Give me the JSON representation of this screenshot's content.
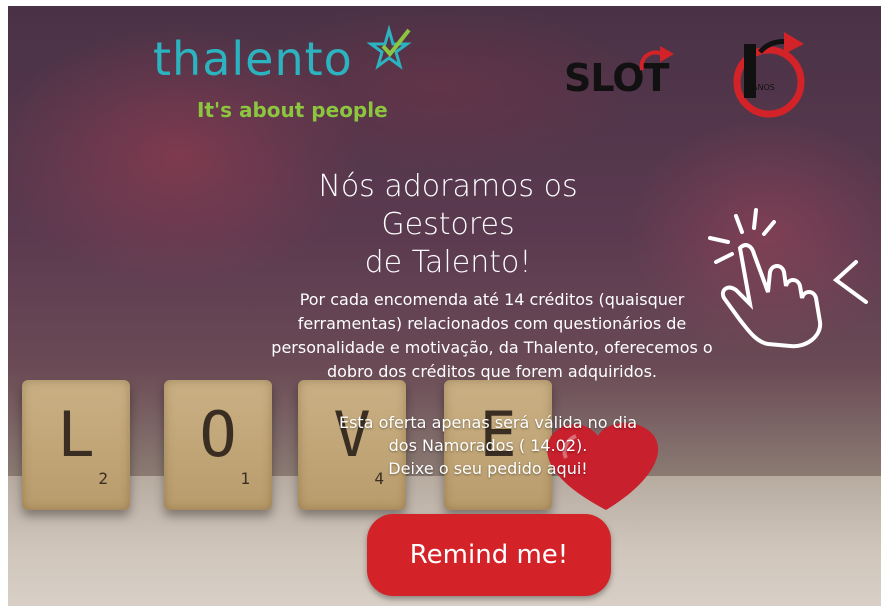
{
  "brand": {
    "name": "thalento",
    "tagline": "It's about people",
    "colors": {
      "teal": "#2bb3c0",
      "green": "#8cc63f",
      "red": "#d32329"
    }
  },
  "partner": {
    "name": "SLOT",
    "anniversary_badge": "ANOS"
  },
  "headline": [
    "Nós adoramos os Gestores",
    "de Talento!"
  ],
  "body": [
    "Por cada encomenda até 14 créditos (quaisquer",
    "ferramentas) relacionados com questionários de",
    "personalidade e motivação, da Thalento, oferecemos o",
    "dobro dos créditos que forem adquiridos."
  ],
  "offer": [
    "Esta oferta apenas será válida no dia",
    "dos Namorados ( 14.02).",
    "Deixe o seu pedido aqui!"
  ],
  "tiles": [
    {
      "letter": "L",
      "sub": "2"
    },
    {
      "letter": "O",
      "sub": "1"
    },
    {
      "letter": "V",
      "sub": "4"
    },
    {
      "letter": "E",
      "sub": ""
    }
  ],
  "icons": {
    "pointer": "hand-pointer-icon",
    "star": "star-icon",
    "heart": "heart-icon"
  },
  "cta": {
    "label": "Remind me!"
  }
}
